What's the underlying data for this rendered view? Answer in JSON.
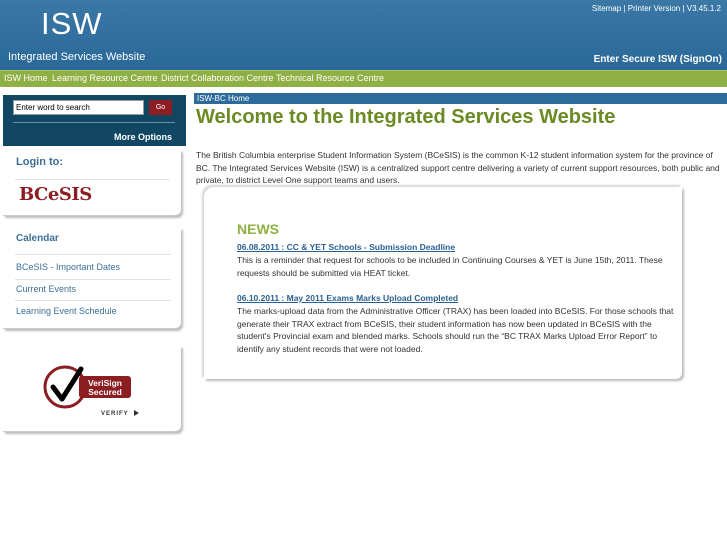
{
  "header": {
    "logo": "ISW",
    "site_name": "Integrated Services Website",
    "top_links": [
      "Sitemap",
      "Printer Version",
      "V3.45.1.2"
    ],
    "separator": " | ",
    "signon": "Enter Secure ISW (SignOn)"
  },
  "nav": {
    "items": [
      "ISW Home",
      "Learning Resource Centre",
      "District Collaboration Centre",
      "Technical Resource Centre"
    ]
  },
  "search": {
    "value": "Enter word to search",
    "go_label": "Go",
    "more_options": "More Options"
  },
  "login": {
    "title": "Login to:",
    "logo_text": "BCeSIS"
  },
  "calendar": {
    "title": "Calendar",
    "items": [
      "BCeSIS - Important Dates",
      "Current Events",
      "Learning Event Schedule"
    ]
  },
  "verisign": {
    "line1": "VeriSign",
    "line2": "Secured",
    "verify": "VERIFY"
  },
  "main": {
    "breadcrumb": "ISW-BC Home",
    "title": "Welcome to the Integrated Services Website",
    "intro": "The British Columbia enterprise Student Information System (BCeSIS) is the common K-12 student information system for the province of BC. The Integrated Services Website (ISW) is a centralized support centre delivering a variety of current support resources, both public and private, to district Level One support teams and users."
  },
  "news": {
    "title": "NEWS",
    "items": [
      {
        "link": "06.08.2011 : CC & YET Schools - Submission Deadline",
        "text": "This is a reminder that request for schools to be included in Continuing Courses & YET is June 15th, 2011. These requests should be submitted via HEAT ticket."
      },
      {
        "link": "06.10.2011 : May 2011 Exams Marks Upload Completed",
        "text": "The marks-upload data from the Administrative Officer (TRAX) has been loaded into BCeSIS. For those schools that generate their TRAX extract from BCeSIS, their student information has now been updated in BCeSIS with the student's Provincial exam and blended marks. Schools should run the “BC TRAX Marks Upload Error Report” to identify any student records that were not loaded."
      }
    ]
  },
  "colors": {
    "header_blue": "#2f6e9e",
    "nav_green": "#8fb044",
    "title_green": "#6b8a24",
    "go_red": "#8c1d21",
    "search_navy": "#124764"
  }
}
